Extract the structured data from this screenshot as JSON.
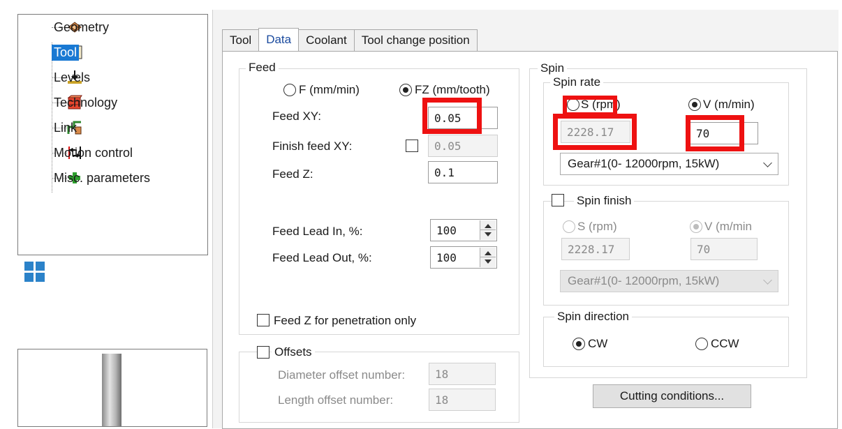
{
  "tree": {
    "items": [
      {
        "label": "Geometry",
        "icon": "geometry-icon"
      },
      {
        "label": "Tool",
        "icon": "tool-icon",
        "selected": true
      },
      {
        "label": "Levels",
        "icon": "levels-icon"
      },
      {
        "label": "Technology",
        "icon": "technology-icon"
      },
      {
        "label": "Link",
        "icon": "link-icon"
      },
      {
        "label": "Motion control",
        "icon": "motion-control-icon"
      },
      {
        "label": "Misc. parameters",
        "icon": "plus-icon"
      }
    ]
  },
  "tabs": [
    {
      "label": "Tool"
    },
    {
      "label": "Data",
      "active": true
    },
    {
      "label": "Coolant"
    },
    {
      "label": "Tool change position"
    }
  ],
  "feed": {
    "title": "Feed",
    "mode_f_label": "F (mm/min)",
    "mode_fz_label": "FZ (mm/tooth)",
    "feed_xy_label": "Feed XY:",
    "feed_xy_value": "0.05",
    "finish_feed_xy_label": "Finish feed XY:",
    "finish_feed_xy_value": "0.05",
    "feed_z_label": "Feed Z:",
    "feed_z_value": "0.1",
    "lead_in_label": "Feed Lead In, %:",
    "lead_in_value": "100",
    "lead_out_label": "Feed Lead Out, %:",
    "lead_out_value": "100",
    "penetration_label": "Feed Z for penetration only"
  },
  "offsets": {
    "title": "Offsets",
    "diameter_label": "Diameter offset number:",
    "diameter_value": "18",
    "length_label": "Length offset number:",
    "length_value": "18"
  },
  "spin": {
    "title": "Spin",
    "rate_title": "Spin rate",
    "s_label": "S (rpm)",
    "v_label": "V (m/min)",
    "s_value": "2228.17",
    "v_value": "70",
    "gear": "Gear#1(0- 12000rpm, 15kW)",
    "finish_title": "Spin finish",
    "finish_s_label": "S (rpm)",
    "finish_v_label": "V (m/min",
    "finish_s_value": "2228.17",
    "finish_v_value": "70",
    "finish_gear": "Gear#1(0- 12000rpm, 15kW)",
    "direction_title": "Spin direction",
    "cw_label": "CW",
    "ccw_label": "CCW"
  },
  "cutting_button": "Cutting conditions...",
  "colors": {
    "highlight": "#ee1111",
    "selection": "#1979d3"
  }
}
